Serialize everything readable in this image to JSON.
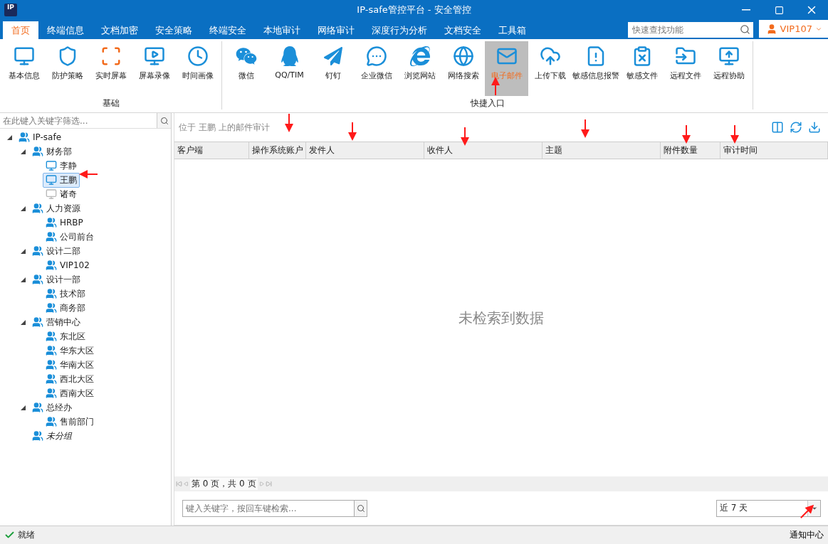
{
  "window": {
    "title": "IP-safe管控平台 - 安全管控",
    "logo": "IP"
  },
  "menu_tabs": [
    {
      "label": "首页",
      "selected": true
    },
    {
      "label": "终端信息",
      "selected": false
    },
    {
      "label": "文档加密",
      "selected": false
    },
    {
      "label": "安全策略",
      "selected": false
    },
    {
      "label": "终端安全",
      "selected": false
    },
    {
      "label": "本地审计",
      "selected": false
    },
    {
      "label": "网络审计",
      "selected": false
    },
    {
      "label": "深度行为分析",
      "selected": false
    },
    {
      "label": "文档安全",
      "selected": false
    },
    {
      "label": "工具箱",
      "selected": false
    }
  ],
  "quick_search": {
    "placeholder": "快速查找功能"
  },
  "user": {
    "name": "VIP107"
  },
  "ribbon_groups": [
    {
      "label": "基础",
      "items": [
        {
          "label": "基本信息",
          "selected": false
        },
        {
          "label": "防护策略",
          "selected": false
        },
        {
          "label": "实时屏幕",
          "selected": false
        },
        {
          "label": "屏幕录像",
          "selected": false
        },
        {
          "label": "时间画像",
          "selected": false
        }
      ]
    },
    {
      "label": "快捷入口",
      "items": [
        {
          "label": "微信",
          "selected": false
        },
        {
          "label": "QQ/TIM",
          "selected": false
        },
        {
          "label": "钉钉",
          "selected": false
        },
        {
          "label": "企业微信",
          "selected": false
        },
        {
          "label": "浏览网站",
          "selected": false
        },
        {
          "label": "网络搜索",
          "selected": false
        },
        {
          "label": "电子邮件",
          "selected": true
        },
        {
          "label": "上传下载",
          "selected": false
        },
        {
          "label": "敏感信息报警",
          "selected": false
        },
        {
          "label": "敏感文件",
          "selected": false
        },
        {
          "label": "远程文件",
          "selected": false
        },
        {
          "label": "远程协助",
          "selected": false
        }
      ]
    }
  ],
  "tree_filter": {
    "placeholder": "在此键入关键字筛选..."
  },
  "tree": [
    {
      "label": "IP-safe",
      "kind": "group",
      "expanded": true,
      "children": [
        {
          "label": "财务部",
          "kind": "group",
          "expanded": true,
          "children": [
            {
              "label": "李静",
              "kind": "computer",
              "online": true,
              "selected": false
            },
            {
              "label": "王鹏",
              "kind": "computer",
              "online": true,
              "selected": true
            },
            {
              "label": "诸奇",
              "kind": "computer",
              "online": false,
              "selected": false
            }
          ]
        },
        {
          "label": "人力资源",
          "kind": "group",
          "expanded": true,
          "children": [
            {
              "label": "HRBP",
              "kind": "group"
            },
            {
              "label": "公司前台",
              "kind": "group"
            }
          ]
        },
        {
          "label": "设计二部",
          "kind": "group",
          "expanded": true,
          "children": [
            {
              "label": "VIP102",
              "kind": "group"
            }
          ]
        },
        {
          "label": "设计一部",
          "kind": "group",
          "expanded": true,
          "children": [
            {
              "label": "技术部",
              "kind": "group"
            },
            {
              "label": "商务部",
              "kind": "group"
            }
          ]
        },
        {
          "label": "营销中心",
          "kind": "group",
          "expanded": true,
          "children": [
            {
              "label": "东北区",
              "kind": "group"
            },
            {
              "label": "华东大区",
              "kind": "group"
            },
            {
              "label": "华南大区",
              "kind": "group"
            },
            {
              "label": "西北大区",
              "kind": "group"
            },
            {
              "label": "西南大区",
              "kind": "group"
            }
          ]
        },
        {
          "label": "总经办",
          "kind": "group",
          "expanded": true,
          "children": [
            {
              "label": "售前部门",
              "kind": "group"
            }
          ]
        },
        {
          "label": "未分组",
          "kind": "ungrouped"
        }
      ]
    }
  ],
  "panel": {
    "caption": "位于 王鹏 上的邮件审计"
  },
  "table": {
    "columns": [
      "客户端",
      "操作系统账户",
      "发件人",
      "收件人",
      "主题",
      "附件数量",
      "审计时间"
    ],
    "empty_message": "未检索到数据"
  },
  "pager": {
    "text": "第 0 页，共 0 页"
  },
  "search": {
    "placeholder": "键入关键字，按回车键检索..."
  },
  "range_select": {
    "value": "近 7 天"
  },
  "status_bar": {
    "status": "就绪",
    "notifications": "通知中心"
  }
}
